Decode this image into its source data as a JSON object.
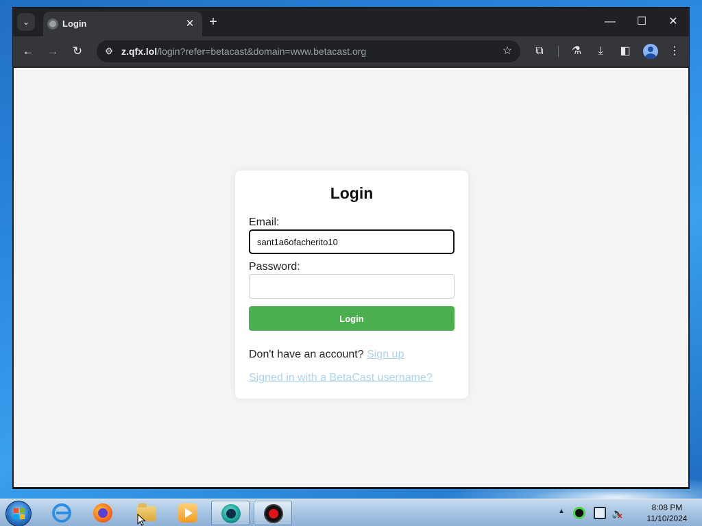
{
  "browser": {
    "tab_list_icon": "chevron-down-icon",
    "tab_title": "Login",
    "tab_close_glyph": "✕",
    "new_tab_glyph": "+",
    "window_controls": {
      "minimize": "—",
      "maximize": "☐",
      "close": "✕"
    },
    "nav": {
      "back": "←",
      "forward": "→",
      "reload": "↻"
    },
    "url_host": "z.qfx.lol",
    "url_rest": "/login?refer=betacast&domain=www.betacast.org",
    "star_glyph": "☆",
    "toolbar_icons": [
      "extensions-icon",
      "labs-icon",
      "download-icon",
      "side-panel-icon",
      "profile-icon",
      "more-icon"
    ]
  },
  "page": {
    "title": "Login",
    "email_label": "Email:",
    "email_value": "sant1a6ofacherito10",
    "password_label": "Password:",
    "password_value": "",
    "login_button": "Login",
    "signup_prompt": "Don't have an account?",
    "signup_link": "Sign up",
    "alt_link": "Signed in with a BetaCast username?",
    "colors": {
      "button": "#4caf50",
      "link": "#a9d3f2",
      "background": "#f4f4f4"
    }
  },
  "taskbar": {
    "apps": [
      "internet-explorer-icon",
      "firefox-icon",
      "file-explorer-icon",
      "media-player-icon",
      "cast-app-icon",
      "record-icon"
    ],
    "tray_arrow": "▲",
    "clock_time": "8:08 PM",
    "clock_date": "11/10/2024"
  }
}
